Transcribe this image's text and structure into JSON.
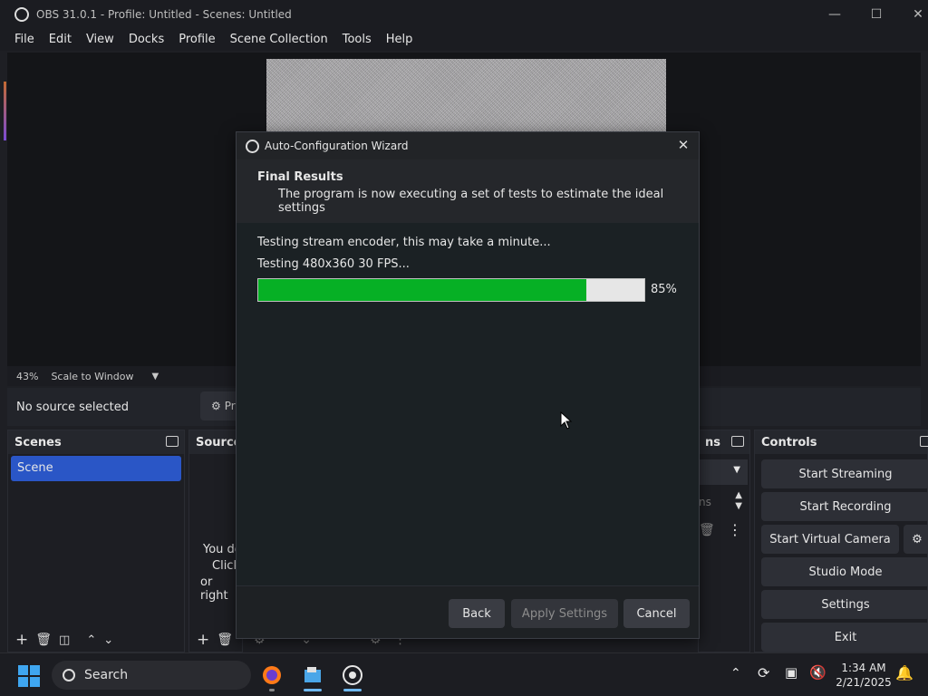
{
  "window": {
    "title": "OBS 31.0.1 - Profile: Untitled - Scenes: Untitled"
  },
  "menu": [
    "File",
    "Edit",
    "View",
    "Docks",
    "Profile",
    "Scene Collection",
    "Tools",
    "Help"
  ],
  "zoombar": {
    "zoom": "43%",
    "scale_mode": "Scale to Window"
  },
  "sourcebar": {
    "no_source": "No source selected",
    "props_label": "Pr"
  },
  "scenes": {
    "title": "Scenes",
    "items": [
      "Scene"
    ]
  },
  "sources": {
    "title": "Source",
    "hint": [
      "You do",
      "Click",
      "or right"
    ]
  },
  "transitions": {
    "title": "ns",
    "partial": "ns"
  },
  "controls": {
    "title": "Controls",
    "buttons": [
      "Start Streaming",
      "Start Recording",
      "Start Virtual Camera",
      "Studio Mode",
      "Settings",
      "Exit"
    ]
  },
  "dialog": {
    "title": "Auto-Configuration Wizard",
    "header_title": "Final Results",
    "header_subtitle": "The program is now executing a set of tests to estimate the ideal settings",
    "status_line_1": "Testing stream encoder, this may take a minute...",
    "status_line_2": "Testing 480x360 30 FPS...",
    "progress_value": 0.85,
    "progress_label": "85%",
    "buttons": {
      "back": "Back",
      "apply": "Apply Settings",
      "cancel": "Cancel"
    }
  },
  "taskbar": {
    "search_label": "Search",
    "time": "1:34 AM",
    "date": "2/21/2025"
  },
  "colors": {
    "accent": "#2a56c6",
    "progress": "#06b025"
  }
}
